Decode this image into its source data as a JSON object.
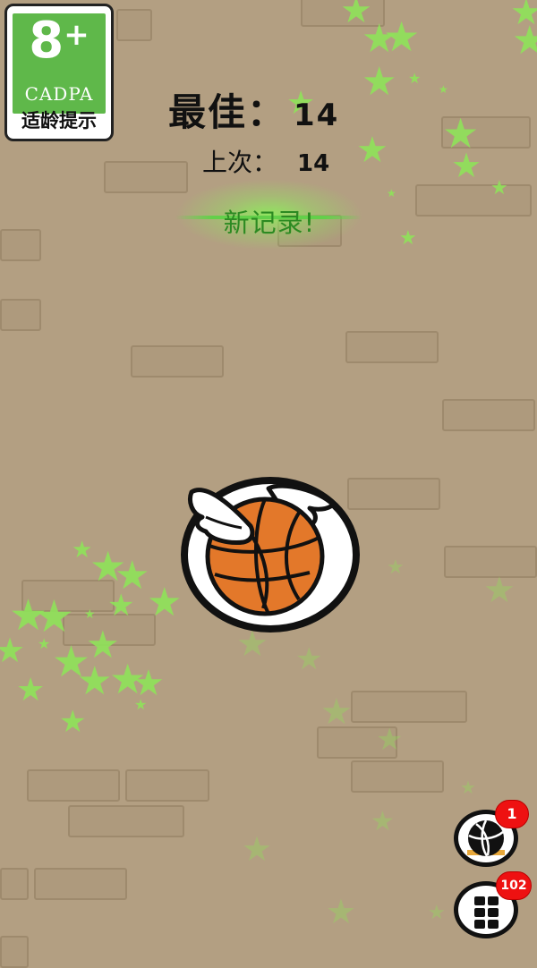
{
  "age_rating": {
    "rating": "8",
    "plus": "+",
    "org": "CADPA",
    "tip": "适龄提示"
  },
  "score": {
    "best_label": "最佳：",
    "best_value": "14",
    "last_label": "上次：",
    "last_value": "14",
    "new_record": "新记录!"
  },
  "player": {
    "icon": "winged-basketball-icon"
  },
  "buttons": {
    "ball_skins": {
      "icon": "basketball-icon",
      "badge": "1"
    },
    "menu": {
      "icon": "grid-icon",
      "badge": "102"
    }
  },
  "colors": {
    "background": "#b39f82",
    "star": "#8fe35a",
    "badge_green": "#5fb84a",
    "record_text": "#2c8a22",
    "ball": "#e3782a",
    "notification": "#e11111"
  }
}
